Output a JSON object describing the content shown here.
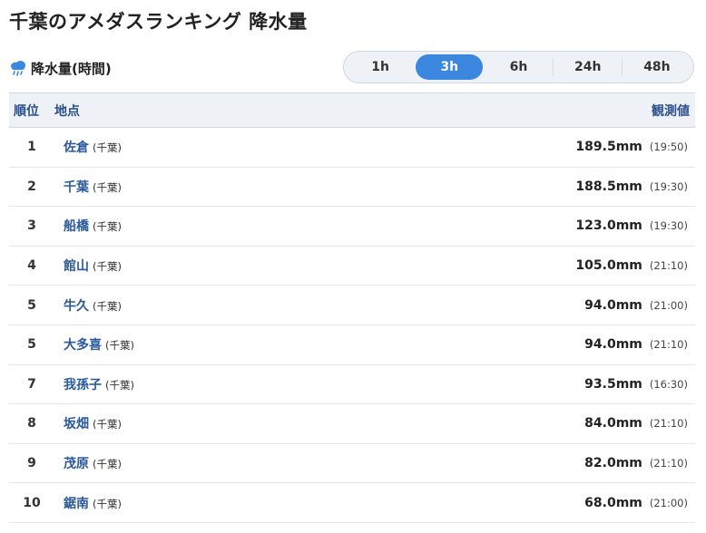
{
  "page": {
    "title": "千葉のアメダスランキング 降水量"
  },
  "section": {
    "label": "降水量(時間)",
    "icon": "rain-cloud-icon"
  },
  "period_tabs": [
    {
      "label": "1h",
      "active": false
    },
    {
      "label": "3h",
      "active": true
    },
    {
      "label": "6h",
      "active": false
    },
    {
      "label": "24h",
      "active": false
    },
    {
      "label": "48h",
      "active": false
    }
  ],
  "table": {
    "headers": {
      "rank": "順位",
      "place": "地点",
      "value": "観測値"
    },
    "rows": [
      {
        "rank": "1",
        "name": "佐倉",
        "pref": "(千葉)",
        "amount": "189.5mm",
        "time": "(19:50)"
      },
      {
        "rank": "2",
        "name": "千葉",
        "pref": "(千葉)",
        "amount": "188.5mm",
        "time": "(19:30)"
      },
      {
        "rank": "3",
        "name": "船橋",
        "pref": "(千葉)",
        "amount": "123.0mm",
        "time": "(19:30)"
      },
      {
        "rank": "4",
        "name": "館山",
        "pref": "(千葉)",
        "amount": "105.0mm",
        "time": "(21:10)"
      },
      {
        "rank": "5",
        "name": "牛久",
        "pref": "(千葉)",
        "amount": "94.0mm",
        "time": "(21:00)"
      },
      {
        "rank": "5",
        "name": "大多喜",
        "pref": "(千葉)",
        "amount": "94.0mm",
        "time": "(21:10)"
      },
      {
        "rank": "7",
        "name": "我孫子",
        "pref": "(千葉)",
        "amount": "93.5mm",
        "time": "(16:30)"
      },
      {
        "rank": "8",
        "name": "坂畑",
        "pref": "(千葉)",
        "amount": "84.0mm",
        "time": "(21:10)"
      },
      {
        "rank": "9",
        "name": "茂原",
        "pref": "(千葉)",
        "amount": "82.0mm",
        "time": "(21:10)"
      },
      {
        "rank": "10",
        "name": "鋸南",
        "pref": "(千葉)",
        "amount": "68.0mm",
        "time": "(21:00)"
      }
    ]
  },
  "colors": {
    "accent": "#3b87e0",
    "link": "#2a5a9c",
    "header_bg": "#eef1f6"
  }
}
